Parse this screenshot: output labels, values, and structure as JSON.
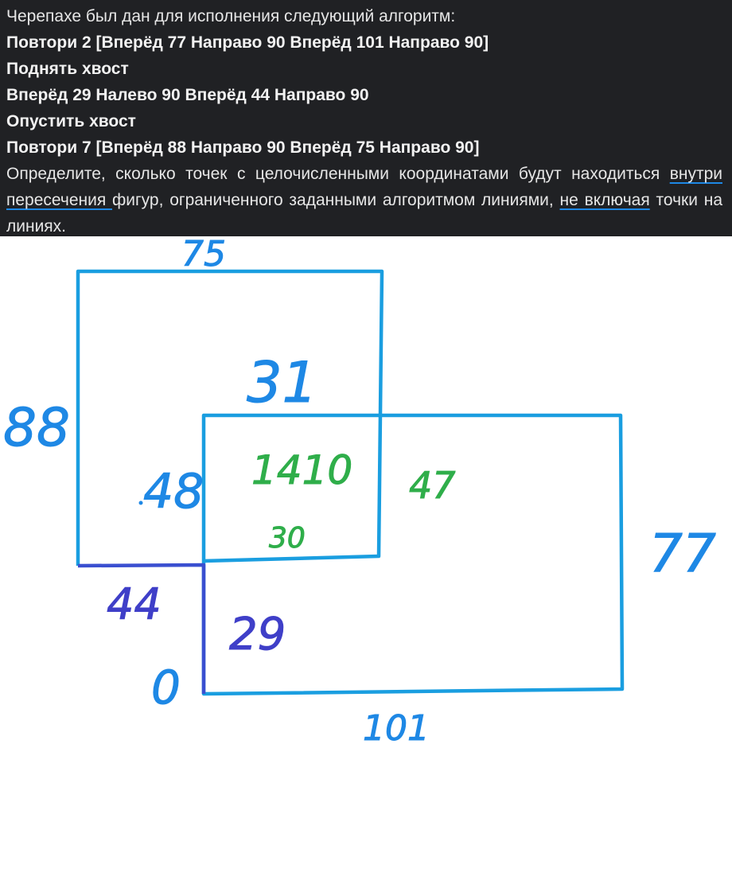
{
  "task": {
    "intro": "Черепахе был дан для исполнения следующий алгоритм:",
    "algorithm": [
      "Повтори 2 [Вперёд 77 Направо 90 Вперёд 101 Направо 90]",
      "Поднять хвост",
      "Вперёд 29 Налево 90 Вперёд 44 Направо 90",
      "Опустить хвост",
      "Повтори 7 [Вперёд 88 Направо 90 Вперёд 75 Направо 90]"
    ],
    "question_part1": "Определите, сколько точек с целочисленными координатами будут находиться ",
    "question_hl1": "внутри пересечения ",
    "question_part2": "фигур, ограниченного заданными алгоритмом линиями, ",
    "question_hl2": "не включая",
    "question_part3": " точки на линиях."
  },
  "sketch": {
    "labels": {
      "top_width": "75",
      "left_height": "88",
      "overlap_height": "31",
      "overlap_count": "1410",
      "left_part": "48",
      "right_part": "47",
      "overlap_width": "30",
      "shift_x": "44",
      "shift_y": "29",
      "origin": "0",
      "right_height": "77",
      "bottom_width": "101"
    },
    "colors": {
      "figure": "#1a9ee0",
      "annotation_blue": "#1e88e5",
      "annotation_green": "#2fae4a",
      "annotation_purple": "#3f3fc8",
      "move_path": "#3a4fd0"
    }
  }
}
